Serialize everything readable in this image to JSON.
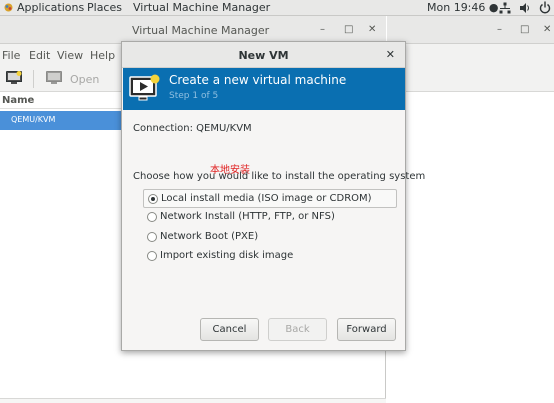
{
  "topbar": {
    "applications": "Applications",
    "places": "Places",
    "app_name": "Virtual Machine Manager",
    "clock": "Mon 19:46 ●",
    "network_icon": "network-icon",
    "volume_icon": "volume-icon",
    "power_icon": "power-icon"
  },
  "bg_window": {
    "title": "Virtual Machine Manager",
    "minimize": "–",
    "maximize": "□",
    "close": "✕",
    "menu": [
      "File",
      "Edit",
      "View",
      "Help"
    ],
    "toolbar_open": "Open",
    "column_name": "Name",
    "selected_row": "QEMU/KVM"
  },
  "right_window": {
    "minimize": "–",
    "maximize": "□",
    "close": "✕"
  },
  "dialog": {
    "title": "New VM",
    "close": "✕",
    "banner_title": "Create a new virtual machine",
    "banner_step": "Step 1 of 5",
    "connection": "Connection:  QEMU/KVM",
    "watermark": "本地安装",
    "choose_label": "Choose how you would like to install the operating system",
    "options": [
      {
        "label": "Local install media (ISO image or CDROM)",
        "selected": true
      },
      {
        "label": "Network Install (HTTP, FTP, or NFS)",
        "selected": false
      },
      {
        "label": "Network Boot (PXE)",
        "selected": false
      },
      {
        "label": "Import existing disk image",
        "selected": false
      }
    ],
    "buttons": {
      "cancel": "Cancel",
      "back": "Back",
      "forward": "Forward"
    }
  },
  "colors": {
    "banner": "#0a6fb1",
    "selection": "#4a90d9",
    "watermark": "#e02020"
  }
}
